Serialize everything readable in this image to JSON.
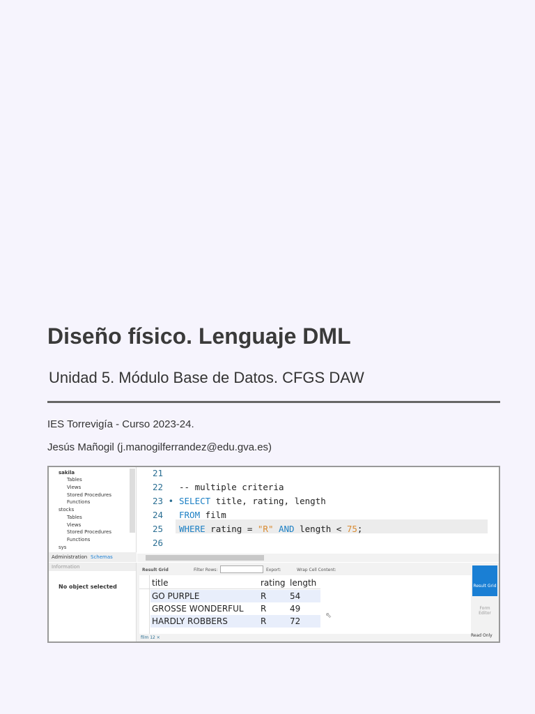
{
  "title": "Diseño físico. Lenguaje DML",
  "subtitle": "Unidad 5. Módulo Base de Datos. CFGS DAW",
  "institution": "IES Torrevigía - Curso 2023-24.",
  "author": "Jesús Mañogil (j.manogilferrandez@edu.gva.es)",
  "screenshot": {
    "navigator": [
      "sakila",
      "Tables",
      "Views",
      "Stored Procedures",
      "Functions",
      "stocks",
      "Tables",
      "Views",
      "Stored Procedures",
      "Functions",
      "sys"
    ],
    "nav_tabs": [
      "Administration",
      "Schemas"
    ],
    "lines": [
      "21",
      "22",
      "23 •",
      "24",
      "25",
      "26"
    ],
    "code": {
      "comment": "-- multiple criteria",
      "select_kw": "SELECT",
      "select_rest": " title, rating, length",
      "from_kw": "FROM",
      "from_rest": " film",
      "where_kw": "WHERE",
      "where_mid": " rating = ",
      "where_str": "\"R\"",
      "and_kw": " AND",
      "where_end": " length < ",
      "num": "75",
      ";": ";"
    },
    "info_header": "Information",
    "no_object": "No object selected",
    "toolbar": {
      "result_grid": "Result Grid",
      "filter": "Filter Rows:",
      "export": "Export:",
      "wrap": "Wrap Cell Content:"
    },
    "columns": [
      "title",
      "rating",
      "length"
    ],
    "rows": [
      [
        "GO PURPLE",
        "R",
        "54"
      ],
      [
        "GROSSE WONDERFUL",
        "R",
        "49"
      ],
      [
        "HARDLY ROBBERS",
        "R",
        "72"
      ]
    ],
    "result_tab": "film 12 ×",
    "side": {
      "result_grid": "Result Grid",
      "form_editor": "Form Editor",
      "read_only": "Read Only"
    }
  }
}
